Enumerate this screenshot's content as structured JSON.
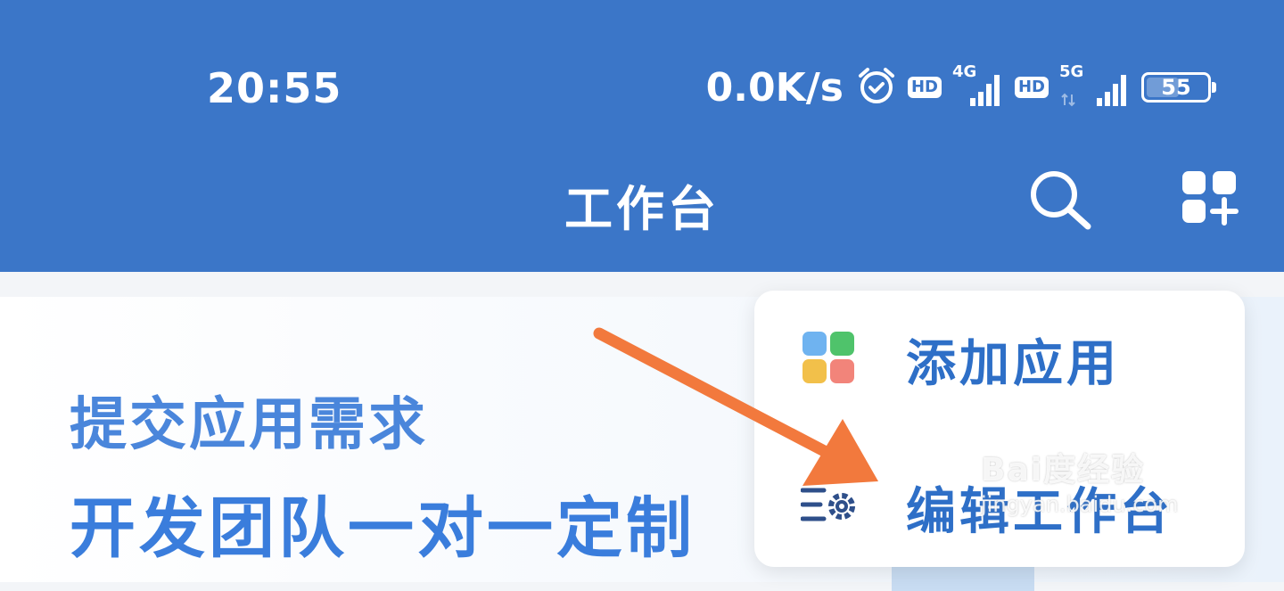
{
  "status_bar": {
    "time": "20:55",
    "net_speed": "0.0K/s",
    "hd_label_1": "HD",
    "net_type_1": "4G",
    "hd_label_2": "HD",
    "net_type_2": "5G",
    "battery": "55",
    "battery_level": 0.55
  },
  "header": {
    "title": "工作台",
    "background_color": "#3b76c8",
    "search_icon": "search-icon",
    "add_app_icon": "apps-add-icon"
  },
  "banner": {
    "line1": "提交应用需求",
    "line2": "开发团队一对一定制"
  },
  "menu": {
    "items": [
      {
        "label": "添加应用",
        "icon": "apps-grid-color-icon"
      },
      {
        "label": "编辑工作台",
        "icon": "list-gear-icon"
      }
    ],
    "accent_color": "#2e6fc7"
  },
  "watermark": {
    "brand": "Bai度经验",
    "url": "jingyan.baidu.com"
  }
}
